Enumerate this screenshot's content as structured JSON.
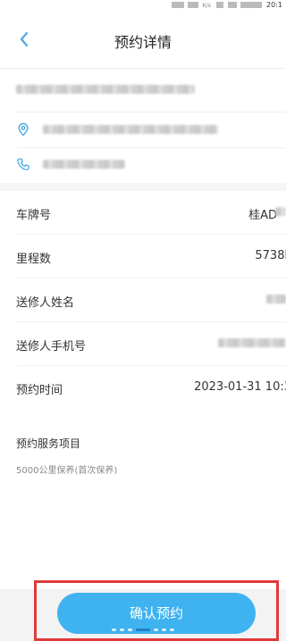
{
  "status_bar": {
    "speed": "K/s",
    "time": "20:1"
  },
  "nav": {
    "title": "预约详情",
    "back_icon": "chevron-left-icon"
  },
  "store": {
    "location_icon": "map-pin-icon",
    "phone_icon": "phone-icon"
  },
  "details": [
    {
      "label": "车牌号",
      "value": "桂AD"
    },
    {
      "label": "里程数",
      "value": "5738k"
    },
    {
      "label": "送修人姓名",
      "value": ""
    },
    {
      "label": "送修人手机号",
      "value": ""
    },
    {
      "label": "预约时间",
      "value": "2023-01-31 10:3"
    }
  ],
  "service": {
    "title": "预约服务项目",
    "item": "5000公里保养(首次保养)"
  },
  "footer": {
    "confirm_label": "确认预约"
  },
  "colors": {
    "accent": "#3fb2f0",
    "highlight_border": "#e03a3a",
    "icon_blue": "#4aa8e0"
  }
}
